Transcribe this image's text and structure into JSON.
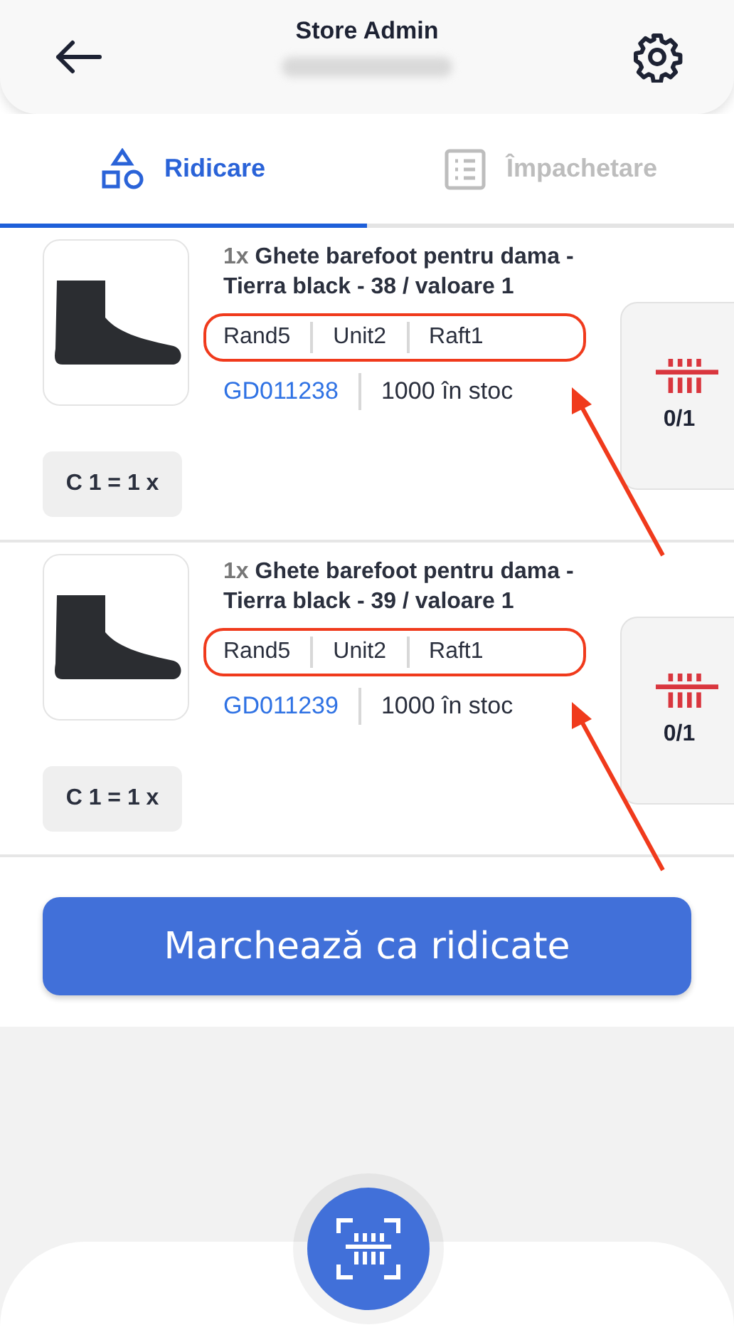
{
  "header": {
    "title": "Store Admin"
  },
  "tabs": [
    {
      "label": "Ridicare",
      "selected": true
    },
    {
      "label": "Împachetare",
      "selected": false
    }
  ],
  "items": [
    {
      "quantity": "1x",
      "name": "Ghete barefoot pentru dama - Tierra black - 38 / valoare 1",
      "locations": [
        "Rand5",
        "Unit2",
        "Raft1"
      ],
      "sku": "GD011238",
      "stock": "1000 în stoc",
      "picked": "0/1",
      "pack_rule": "C 1 = 1 x",
      "highlighted": true
    },
    {
      "quantity": "1x",
      "name": "Ghete barefoot pentru dama - Tierra black - 39 / valoare 1",
      "locations": [
        "Rand5",
        "Unit2",
        "Raft1"
      ],
      "sku": "GD011239",
      "stock": "1000 în stoc",
      "picked": "0/1",
      "pack_rule": "C 1 = 1 x",
      "highlighted": true
    }
  ],
  "primary_button": {
    "label": "Marchează ca ridicate"
  }
}
